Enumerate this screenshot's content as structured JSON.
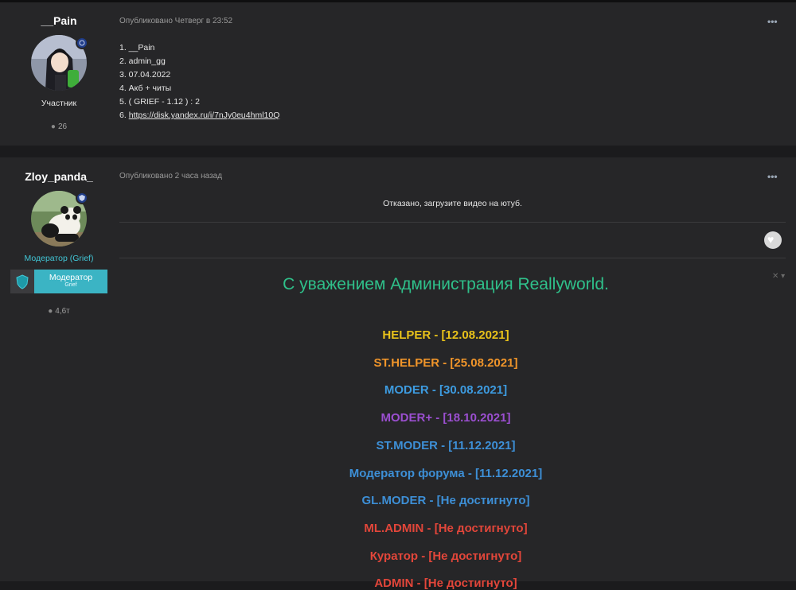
{
  "post1": {
    "author": "__Pain",
    "role": "Участник",
    "post_count": "26",
    "meta": "Опубликовано Четверг в 23:52",
    "more_label": "•••",
    "lines": [
      "1. __Pain",
      "2. admin_gg",
      "3. 07.04.2022",
      "4. Акб + читы",
      "5. ( GRIEF - 1.12 ) : 2"
    ],
    "link_prefix": "6. ",
    "link_text": "https://disk.yandex.ru/i/7nJy0eu4hml10Q"
  },
  "post2": {
    "author": "Zloy_panda_",
    "role": "Модератор (Grief)",
    "badge_title": "Модератор",
    "badge_sub": "Grief",
    "post_count": "4,6т",
    "meta": "Опубликовано 2 часа назад",
    "more_label": "•••",
    "message": "Отказано, загрузите видео на ютуб.",
    "close_label": "✕ ▾",
    "signature_heading": "С уважением Администрация Reallyworld.",
    "signature_lines": [
      {
        "text": "HELPER - [12.08.2021]",
        "color": "#e8c21a"
      },
      {
        "text": "ST.HELPER - [25.08.2021]",
        "color": "#f0952a"
      },
      {
        "text": "MODER - [30.08.2021]",
        "color": "#3d9be0"
      },
      {
        "text": "MODER+ - [18.10.2021]",
        "color": "#9b4fd0"
      },
      {
        "text": "ST.MODER - [11.12.2021]",
        "color": "#3d8fd6"
      },
      {
        "text": "Модератор форума - [11.12.2021]",
        "color": "#3d8fd6"
      },
      {
        "text": "GL.MODER - [Не достигнуто]",
        "color": "#3d8fd6"
      },
      {
        "text": "ML.ADMIN - [Не достигнуто]",
        "color": "#e2463a"
      },
      {
        "text": "Куратор - [Не достигнуто]",
        "color": "#e2463a"
      },
      {
        "text": "ADMIN - [Не достигнуто]",
        "color": "#e2463a"
      }
    ]
  },
  "icons": {
    "comment": "comment-bubble-icon",
    "heart": "heart-icon",
    "shield": "shield-icon"
  }
}
